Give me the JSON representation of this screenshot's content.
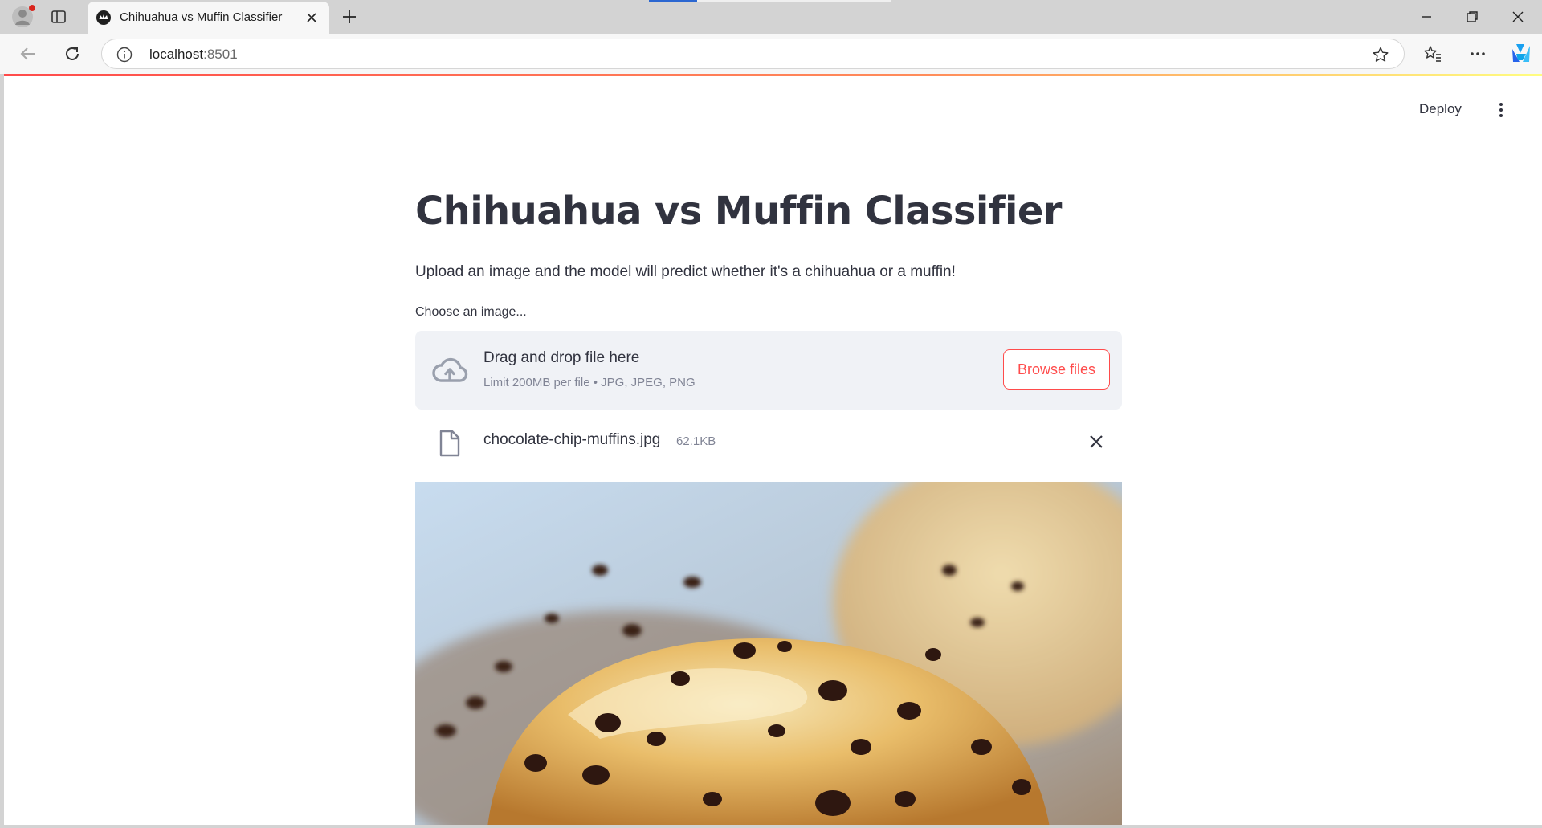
{
  "browser": {
    "tab_title": "Chihuahua vs Muffin Classifier",
    "url_host": "localhost",
    "url_port": ":8501"
  },
  "header": {
    "deploy_label": "Deploy"
  },
  "main": {
    "title": "Chihuahua vs Muffin Classifier",
    "subtitle": "Upload an image and the model will predict whether it's a chihuahua or a muffin!",
    "uploader": {
      "label": "Choose an image...",
      "dropzone_title": "Drag and drop file here",
      "dropzone_limit": "Limit 200MB per file • JPG, JPEG, PNG",
      "browse_label": "Browse files"
    },
    "file": {
      "name": "chocolate-chip-muffins.jpg",
      "size": "62.1KB"
    }
  },
  "colors": {
    "accent": "#ff4b4b",
    "text": "#31333f",
    "muted": "#808495",
    "dropzone_bg": "#f0f2f6"
  }
}
